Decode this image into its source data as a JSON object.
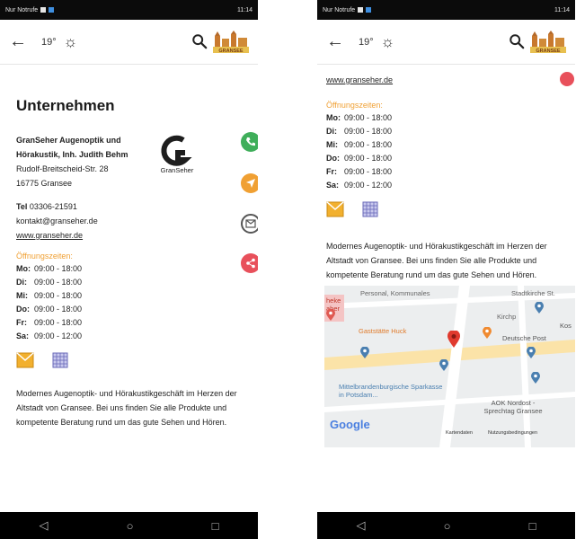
{
  "status_bar": {
    "carrier": "Nur Notrufe",
    "time": "11:14"
  },
  "app_bar": {
    "temperature": "19°",
    "weather_icon": "sun-icon",
    "search_icon": "search-icon",
    "logo_text": "GRANSEE"
  },
  "company": {
    "section_title": "Unternehmen",
    "name": "GranSeher Augenoptik und Hörakustik, Inh. Judith Behm",
    "street": "Rudolf-Breitscheid-Str. 28",
    "city": "16775 Gransee",
    "phone_label": "Tel",
    "phone": "03306-21591",
    "email": "kontakt@granseher.de",
    "website": "www.granseher.de",
    "logo_name": "GranSeher"
  },
  "hours": {
    "title": "Öffnungszeiten:",
    "rows": [
      {
        "day": "Mo:",
        "time": "09:00 - 18:00"
      },
      {
        "day": "Di:",
        "time": "09:00 - 18:00"
      },
      {
        "day": "Mi:",
        "time": "09:00 - 18:00"
      },
      {
        "day": "Do:",
        "time": "09:00 - 18:00"
      },
      {
        "day": "Fr:",
        "time": "09:00 - 18:00"
      },
      {
        "day": "Sa:",
        "time": "09:00 - 12:00"
      }
    ]
  },
  "description": "Modernes Augenoptik- und Hörakustikgeschäft im Herzen der Altstadt von Gransee. Bei uns finden Sie alle Produkte und kompetente Beratung rund um das gute Sehen und Hören.",
  "colors": {
    "phone": "#3fae5a",
    "route": "#f0a033",
    "mail": "#555555",
    "share": "#e8505b",
    "accent": "#f0a033"
  },
  "map": {
    "labels": {
      "personal": "Personal, Kommunales",
      "church": "Stadtkirche St.",
      "heke": "heke aber",
      "gaststaette": "Gaststätte Huck",
      "kirch": "Kirchp",
      "deutsche_post": "Deutsche Post",
      "kos": "Kos",
      "sparkasse": "Mittelbrandenburgische Sparkasse in Potsdam...",
      "aok": "AOK Nordost - Sprechtag Gransee",
      "google": "Google",
      "kartendaten": "Kartendaten",
      "nutzung": "Nutzungsbedingungen"
    }
  }
}
